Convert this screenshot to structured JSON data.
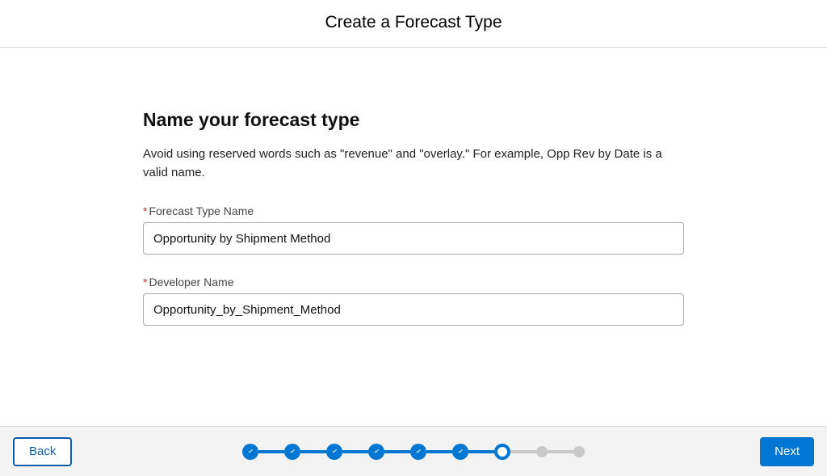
{
  "header": {
    "title": "Create a Forecast Type"
  },
  "section": {
    "title": "Name your forecast type",
    "description": "Avoid using reserved words such as \"revenue\" and \"overlay.\" For example, Opp Rev by Date is a valid name."
  },
  "fields": {
    "forecastTypeName": {
      "label": "Forecast Type Name",
      "value": "Opportunity by Shipment Method"
    },
    "developerName": {
      "label": "Developer Name",
      "value": "Opportunity_by_Shipment_Method"
    }
  },
  "footer": {
    "back": "Back",
    "next": "Next"
  },
  "progress": {
    "totalSteps": 9,
    "completedSteps": 6,
    "currentStep": 7
  }
}
